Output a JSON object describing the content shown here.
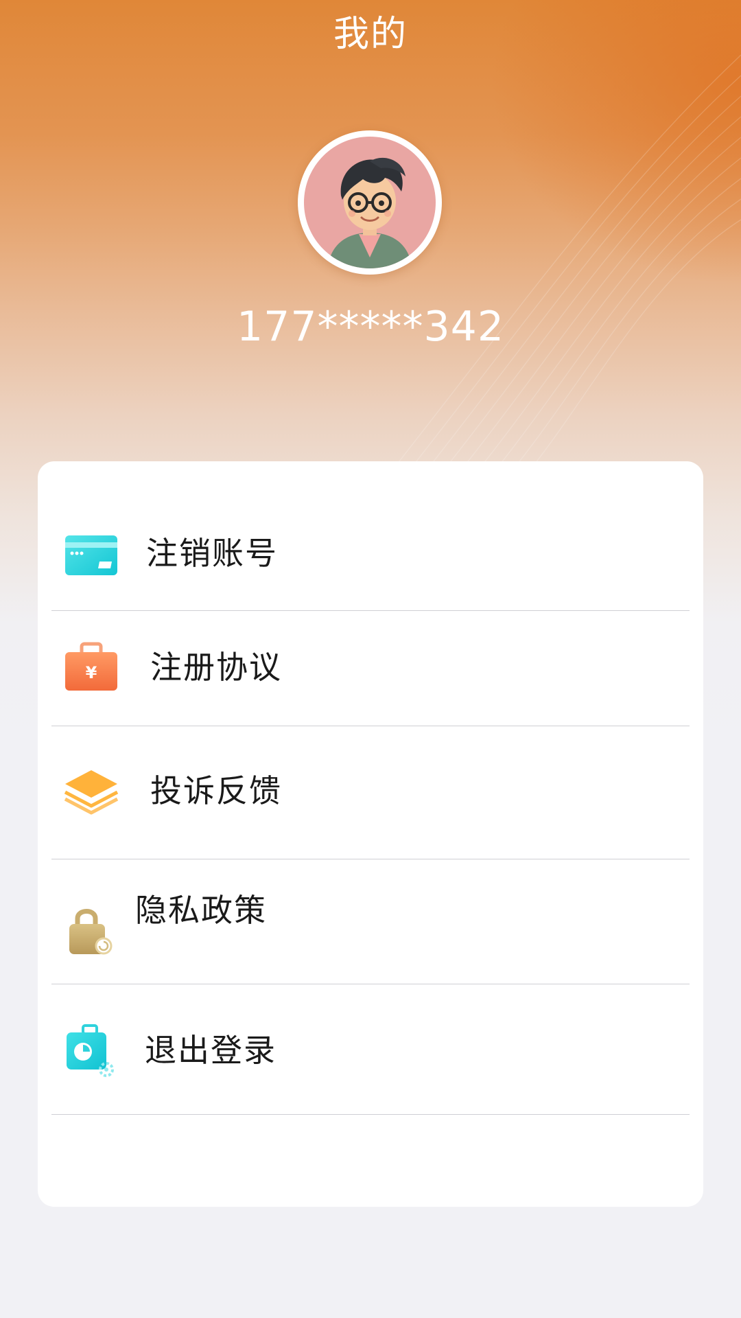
{
  "header": {
    "title": "我的"
  },
  "profile": {
    "avatar_icon": "cartoon-avatar-boy-glasses",
    "phone": "177*****342"
  },
  "menu": {
    "items": [
      {
        "label": "注销账号",
        "icon": "card-icon"
      },
      {
        "label": "注册协议",
        "icon": "briefcase-yen-icon"
      },
      {
        "label": "投诉反馈",
        "icon": "layers-icon"
      },
      {
        "label": "隐私政策",
        "icon": "lock-icon"
      },
      {
        "label": "退出登录",
        "icon": "badge-settings-icon"
      }
    ]
  },
  "colors": {
    "accent": "#e08738",
    "card_background": "#ffffff",
    "page_background": "#f1f1f5",
    "divider": "#cfcfd4"
  }
}
